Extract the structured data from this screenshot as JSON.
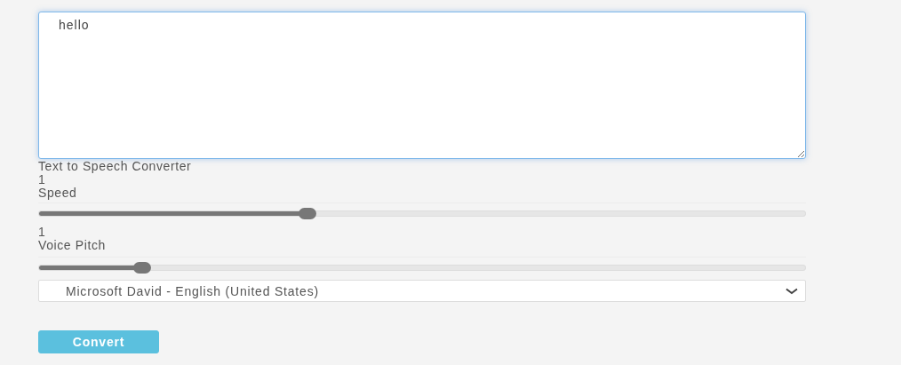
{
  "text_input": {
    "value": "hello"
  },
  "title": "Text to Speech Converter",
  "sliders": [
    {
      "reading": "1",
      "label": "Speed",
      "level": 0.35
    },
    {
      "reading": "1",
      "label": "Voice Pitch",
      "level": 0.135
    }
  ],
  "voice_select": {
    "value": "Microsoft David - English (United States)"
  },
  "convert_button": {
    "label": "Convert"
  }
}
